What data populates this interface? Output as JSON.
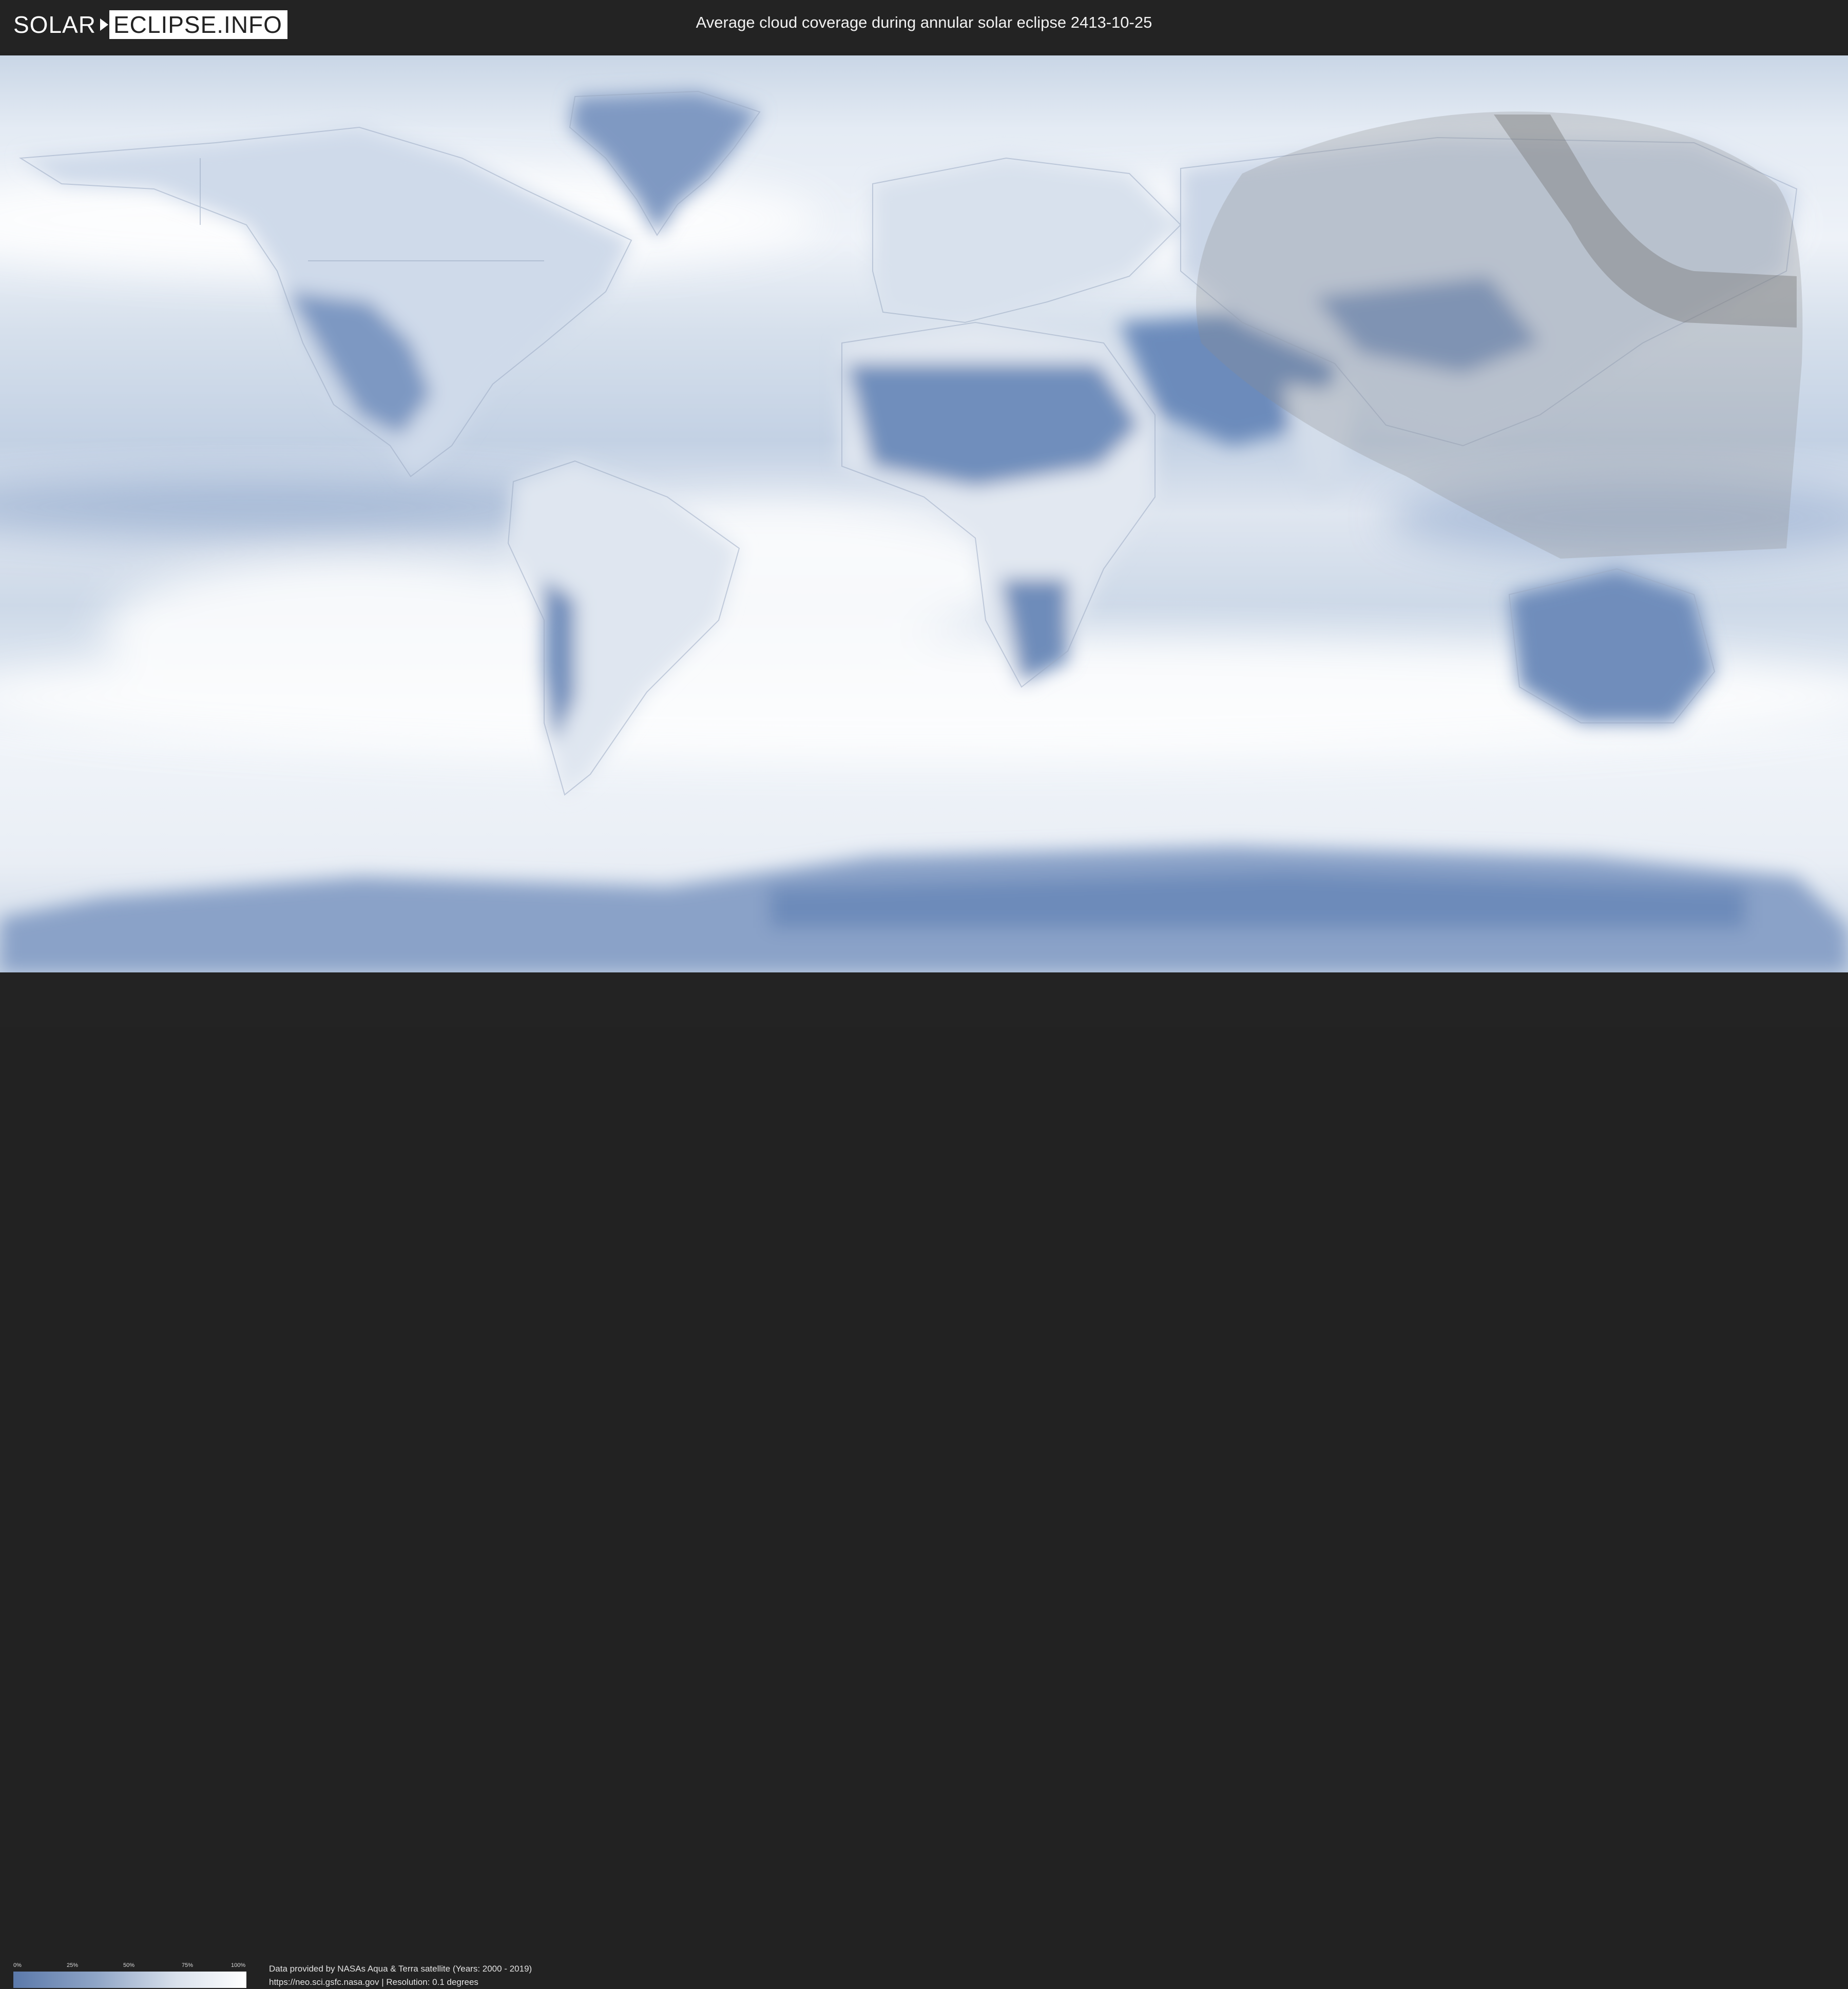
{
  "header": {
    "logo_left": "SOLAR",
    "logo_right": "ECLIPSE.INFO",
    "title": "Average cloud coverage during annular solar eclipse 2413-10-25"
  },
  "legend": {
    "ticks": [
      "0%",
      "25%",
      "50%",
      "75%",
      "100%"
    ],
    "color_low": "#5b79aa",
    "color_high": "#ffffff"
  },
  "credits": {
    "line1": "Data provided by NASAs Aqua & Terra satellite (Years: 2000 - 2019)",
    "line2": "https://neo.sci.gsfc.nasa.gov | Resolution: 0.1 degrees"
  },
  "colors": {
    "cloud_light": "#f3f6fa",
    "cloud_dark": "#5d7caf",
    "eclipse_overlay": "#8c8c8c"
  }
}
